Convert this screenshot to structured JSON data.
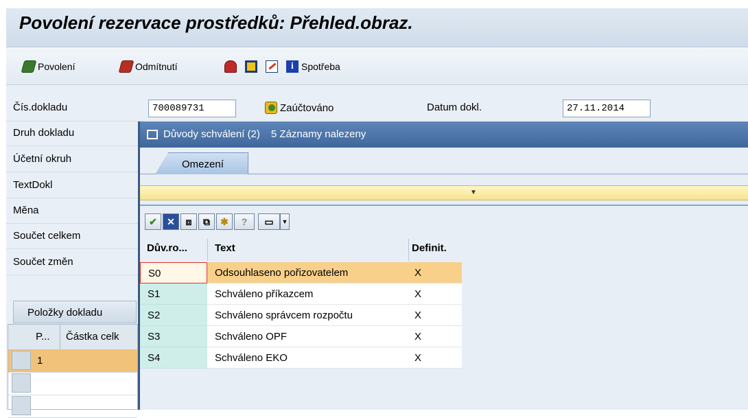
{
  "window": {
    "title": "Povolení rezervace prostředků: Přehled.obraz."
  },
  "toolbar": {
    "approve": {
      "label": "Povolení",
      "icon": "approve-pen-icon"
    },
    "reject": {
      "label": "Odmítnutí",
      "icon": "reject-pen-icon"
    },
    "consumption": {
      "label": "Spotřeba",
      "icon": "info-icon"
    }
  },
  "form": {
    "doc_number": {
      "label": "Čís.dokladu",
      "value": "700089731"
    },
    "status": {
      "label": "Zaúčtováno",
      "icon": "posted-icon"
    },
    "doc_date": {
      "label": "Datum dokl.",
      "value": "27.11.2014"
    },
    "doc_type": {
      "label": "Druh dokladu"
    },
    "company_code": {
      "label": "Účetní okruh"
    },
    "doc_text": {
      "label": "TextDokl"
    },
    "currency": {
      "label": "Měna"
    },
    "total": {
      "label": "Součet celkem"
    },
    "total_changes": {
      "label": "Součet změn"
    }
  },
  "items": {
    "tab_label": "Položky dokladu",
    "columns": [
      "P...",
      "Částka celk"
    ],
    "rows": [
      {
        "pos": "1"
      }
    ]
  },
  "dialog": {
    "title": "Důvody schválení (2)",
    "records": "5 Záznamy nalezeny",
    "tab": "Omezení",
    "columns": {
      "key": "Dův.ro...",
      "text": "Text",
      "def": "Definit."
    },
    "rows": [
      {
        "key": "S0",
        "text": "Odsouhlaseno pořizovatelem",
        "def": "X"
      },
      {
        "key": "S1",
        "text": "Schváleno příkazcem",
        "def": "X"
      },
      {
        "key": "S2",
        "text": "Schváleno správcem rozpočtu",
        "def": "X"
      },
      {
        "key": "S3",
        "text": "Schváleno OPF",
        "def": "X"
      },
      {
        "key": "S4",
        "text": "Schváleno EKO",
        "def": "X"
      }
    ]
  },
  "colors": {
    "selected_row": "#f8d08a",
    "key_column": "#cfeeea",
    "title_bar": "#4a72a8",
    "condition_bar": "#f6e38e"
  }
}
